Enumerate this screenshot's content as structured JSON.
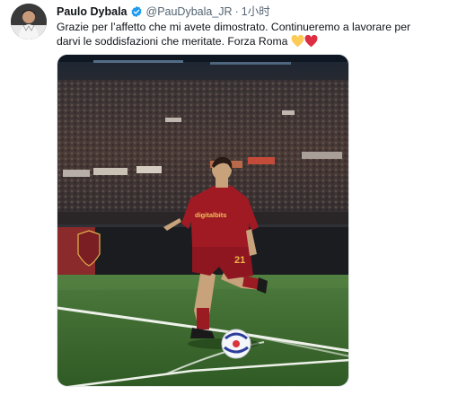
{
  "tweet": {
    "author": {
      "display_name": "Paulo Dybala",
      "handle": "@PauDybala_JR",
      "avatar_icon": "avatar-photo",
      "verified_icon": "verified-badge-icon",
      "verified_color": "#1d9bf0"
    },
    "separator": "·",
    "timestamp": "1小时",
    "text_line_1": "Grazie per l’affetto che mi avete dimostrato. Continueremo a lavorare per",
    "text_line_2": "darvi le soddisfazioni che meritate. Forza Roma",
    "emojis": [
      "yellow-heart-icon",
      "red-heart-icon"
    ],
    "media": {
      "type": "photo",
      "jersey_sponsor": "digitalbits",
      "jersey_number": "21"
    }
  }
}
